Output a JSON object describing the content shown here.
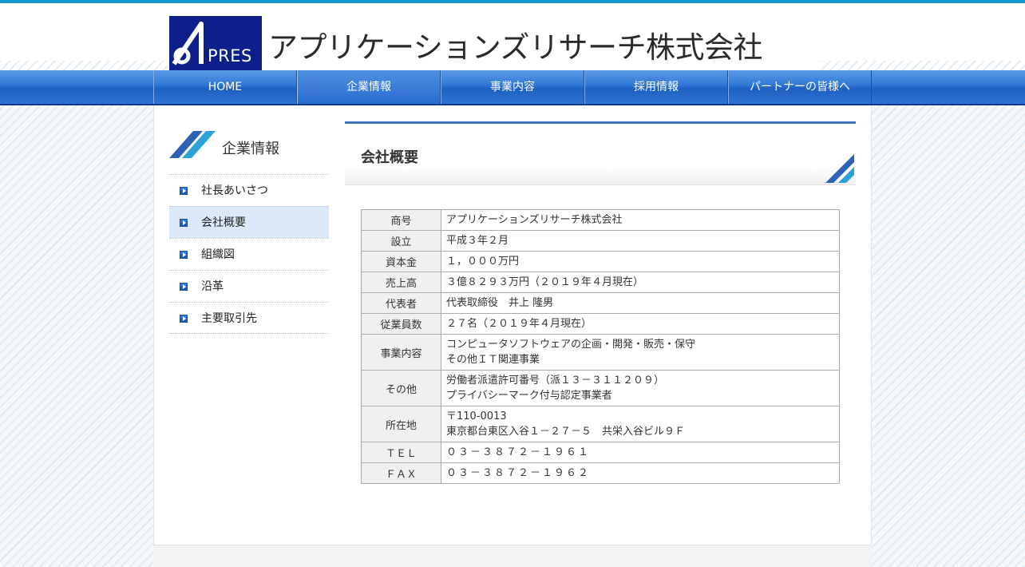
{
  "brand": {
    "logo_text": "PRES",
    "logo_color": "#0c1f8a",
    "company_name": "アプリケーションズリサーチ株式会社"
  },
  "colors": {
    "nav": "#2f76d6",
    "accent": "#3f73b8",
    "top_line": "#1996c8",
    "sidebar_active": "#dbe9fb"
  },
  "nav": {
    "items": [
      {
        "label": "HOME"
      },
      {
        "label": "企業情報"
      },
      {
        "label": "事業内容"
      },
      {
        "label": "採用情報"
      },
      {
        "label": "パートナーの皆様へ"
      }
    ],
    "active": "企業情報"
  },
  "sidebar": {
    "title": "企業情報",
    "items": [
      {
        "label": "社長あいさつ"
      },
      {
        "label": "会社概要"
      },
      {
        "label": "組織図"
      },
      {
        "label": "沿革"
      },
      {
        "label": "主要取引先"
      }
    ],
    "active": "会社概要"
  },
  "main": {
    "title": "会社概要",
    "rows": [
      {
        "label": "商号",
        "lines": [
          "アプリケーションズリサーチ株式会社"
        ]
      },
      {
        "label": "設立",
        "lines": [
          "平成３年２月"
        ]
      },
      {
        "label": "資本金",
        "lines": [
          "１，０００万円"
        ]
      },
      {
        "label": "売上高",
        "lines": [
          "３億８２９３万円（２０１９年４月現在）"
        ]
      },
      {
        "label": "代表者",
        "lines": [
          "代表取締役　井上 隆男"
        ]
      },
      {
        "label": "従業員数",
        "lines": [
          "２７名（２０１９年４月現在）"
        ]
      },
      {
        "label": "事業内容",
        "lines": [
          "コンピュータソフトウェアの企画・開発・販売・保守",
          "その他ＩＴ関連事業"
        ]
      },
      {
        "label": "その他",
        "lines": [
          "労働者派遣許可番号（派１３－３１１２０９）",
          "プライバシーマーク付与認定事業者"
        ]
      },
      {
        "label": "所在地",
        "lines": [
          "〒110-0013",
          "東京都台東区入谷１－２７－５　共栄入谷ビル９Ｆ"
        ]
      },
      {
        "label": "ＴＥＬ",
        "lines": [
          "０３－３８７２－１９６１"
        ]
      },
      {
        "label": "ＦＡＸ",
        "lines": [
          "０３－３８７２－１９６２"
        ]
      }
    ]
  }
}
